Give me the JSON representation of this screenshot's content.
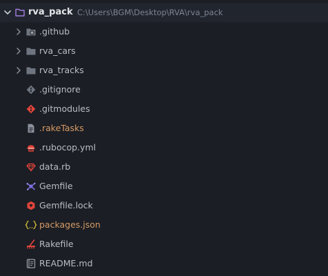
{
  "root": {
    "name": "rva_pack",
    "path": "C:\\Users\\BGM\\Desktop\\RVA\\rva_pack"
  },
  "colors": {
    "background": "#1b1e24",
    "root_row_bg": "#21252d",
    "folder_accent": "#a67ce0",
    "modified_text": "#d69a66"
  },
  "items": [
    {
      "label": ".github",
      "icon": "github-folder-icon",
      "kind": "folder"
    },
    {
      "label": "rva_cars",
      "icon": "folder-icon",
      "kind": "folder"
    },
    {
      "label": "rva_tracks",
      "icon": "folder-icon",
      "kind": "folder"
    },
    {
      "label": ".gitignore",
      "icon": "git-icon",
      "kind": "file"
    },
    {
      "label": ".gitmodules",
      "icon": "git-red-icon",
      "kind": "file"
    },
    {
      "label": ".rakeTasks",
      "icon": "document-icon",
      "kind": "file"
    },
    {
      "label": ".rubocop.yml",
      "icon": "rubocop-icon",
      "kind": "file"
    },
    {
      "label": "data.rb",
      "icon": "ruby-icon",
      "kind": "file"
    },
    {
      "label": "Gemfile",
      "icon": "bundler-icon",
      "kind": "file"
    },
    {
      "label": "Gemfile.lock",
      "icon": "gem-lock-icon",
      "kind": "file"
    },
    {
      "label": "packages.json",
      "icon": "json-icon",
      "kind": "file"
    },
    {
      "label": "Rakefile",
      "icon": "rake-icon",
      "kind": "file"
    },
    {
      "label": "README.md",
      "icon": "readme-icon",
      "kind": "file"
    }
  ]
}
